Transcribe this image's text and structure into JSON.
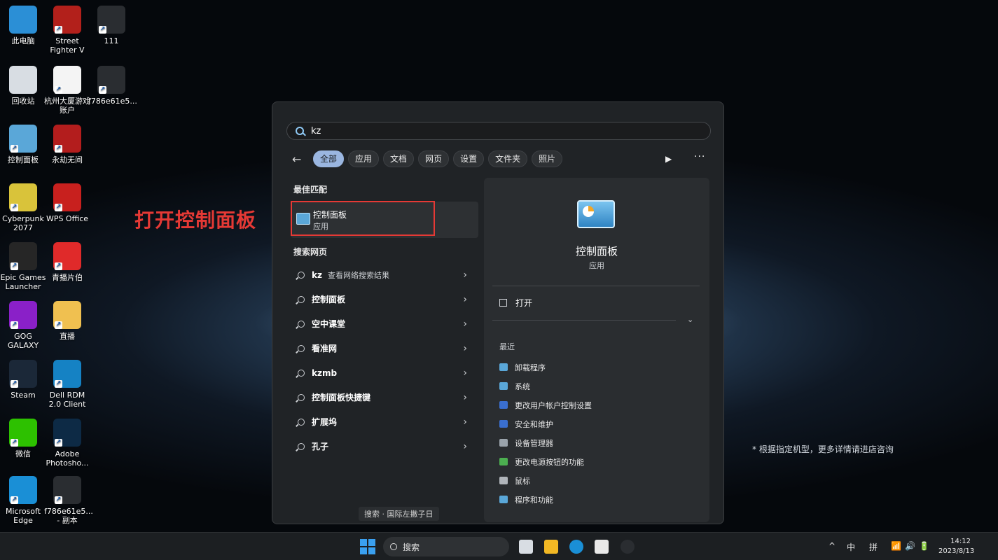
{
  "desktop": {
    "icons": [
      {
        "label": "此电脑",
        "color": "#2b8fd6"
      },
      {
        "label": "Street Fighter V",
        "color": "#b2201b"
      },
      {
        "label": "111",
        "color": "#2a2d31"
      },
      {
        "label": "回收站",
        "color": "#d8dde3"
      },
      {
        "label": "杭州大厦游戏账户",
        "color": "#f4f4f4"
      },
      {
        "label": "f786e61e5...",
        "color": "#2a2d31"
      },
      {
        "label": "控制面板",
        "color": "#5aa7d8"
      },
      {
        "label": "永劫无间",
        "color": "#b31d1d"
      },
      {
        "label": "Cyberpunk 2077",
        "color": "#d9c33a"
      },
      {
        "label": "WPS Office",
        "color": "#c8201e"
      },
      {
        "label": "Epic Games Launcher",
        "color": "#262626"
      },
      {
        "label": "青播片伯",
        "color": "#e02a2a"
      },
      {
        "label": "GOG GALAXY",
        "color": "#8a20c8"
      },
      {
        "label": "直播",
        "color": "#f0c050"
      },
      {
        "label": "Steam",
        "color": "#1b2838"
      },
      {
        "label": "Dell RDM 2.0 Client",
        "color": "#1582c4"
      },
      {
        "label": "微信",
        "color": "#2dc100"
      },
      {
        "label": "Adobe Photosho...",
        "color": "#0d2a45"
      },
      {
        "label": "Microsoft Edge",
        "color": "#1a8fd6"
      },
      {
        "label": "f786e61e5... - 副本",
        "color": "#2a2d31"
      }
    ],
    "annotation": "打开控制面板",
    "note": "* 根据指定机型，更多详情请进店咨询"
  },
  "search": {
    "query": "kz",
    "filters": [
      "全部",
      "应用",
      "文档",
      "网页",
      "设置",
      "文件夹",
      "照片"
    ],
    "best_match_title": "最佳匹配",
    "best_match": {
      "name": "控制面板",
      "type": "应用"
    },
    "web_title": "搜索网页",
    "web_items": [
      {
        "q": "kz",
        "extra": "查看网络搜索结果"
      },
      {
        "q": "控制面板",
        "extra": ""
      },
      {
        "q": "空中课堂",
        "extra": ""
      },
      {
        "q": "看准网",
        "extra": ""
      },
      {
        "q": "kzmb",
        "extra": ""
      },
      {
        "q": "控制面板快捷键",
        "extra": ""
      },
      {
        "q": "扩展坞",
        "extra": ""
      },
      {
        "q": "孔子",
        "extra": ""
      }
    ],
    "footer_hint": "搜索 · 国际左撇子日"
  },
  "detail": {
    "name": "控制面板",
    "type": "应用",
    "open_label": "打开",
    "recent_title": "最近",
    "recent": [
      {
        "label": "卸载程序",
        "color": "#5aa7d8"
      },
      {
        "label": "系统",
        "color": "#5aa7d8"
      },
      {
        "label": "更改用户帐户控制设置",
        "color": "#3a6fd0"
      },
      {
        "label": "安全和维护",
        "color": "#3a6fd0"
      },
      {
        "label": "设备管理器",
        "color": "#9aa3ab"
      },
      {
        "label": "更改电源按钮的功能",
        "color": "#4caf50"
      },
      {
        "label": "鼠标",
        "color": "#b0b5ba"
      },
      {
        "label": "程序和功能",
        "color": "#5aa7d8"
      }
    ]
  },
  "taskbar": {
    "search_label": "搜索",
    "tray": {
      "chevron": "^",
      "ime": "中",
      "ime2": "拼"
    },
    "time": "14:12",
    "date": "2023/8/13"
  }
}
